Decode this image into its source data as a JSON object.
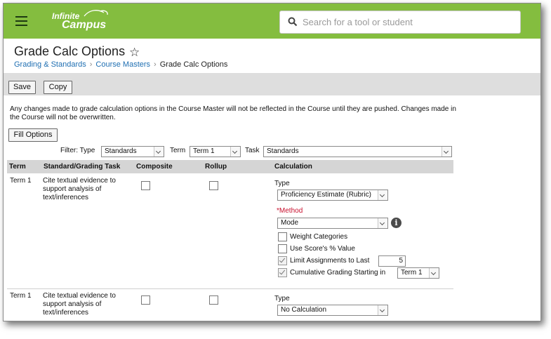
{
  "header": {
    "logo_line1": "Infinite",
    "logo_line2": "Campus",
    "search_placeholder": "Search for a tool or student",
    "brand_color": "#84bd3f"
  },
  "page": {
    "title": "Grade Calc Options",
    "breadcrumbs": [
      "Grading & Standards",
      "Course Masters",
      "Grade Calc Options"
    ]
  },
  "toolbar": {
    "save_label": "Save",
    "copy_label": "Copy"
  },
  "notice": "Any changes made to grade calculation options in the Course Master will not be reflected in the Course until they are pushed. Changes made in the Course will not be overwritten.",
  "fill_options_label": "Fill Options",
  "filter": {
    "filter_type_label": "Filter: Type",
    "type_value": "Standards",
    "term_label": "Term",
    "term_value": "Term 1",
    "task_label": "Task",
    "task_value": "Standards"
  },
  "table": {
    "headers": [
      "Term",
      "Standard/Grading Task",
      "Composite",
      "Rollup",
      "Calculation"
    ],
    "rows": [
      {
        "term": "Term 1",
        "task": "Cite textual evidence to support analysis of text/inferences",
        "composite": false,
        "rollup": false,
        "type_label": "Type",
        "type_value": "Proficiency Estimate (Rubric)",
        "method_required": "*",
        "method_label": "Method",
        "method_value": "Mode",
        "weight_categories_label": "Weight Categories",
        "weight_categories": false,
        "use_score_label": "Use Score's % Value",
        "use_score": false,
        "limit_label": "Limit Assignments to Last",
        "limit": true,
        "limit_value": "5",
        "cumulative_label": "Cumulative Grading Starting in",
        "cumulative": true,
        "cumulative_value": "Term 1"
      },
      {
        "term": "Term 1",
        "task": "Cite textual evidence to support analysis of text/inferences",
        "composite": false,
        "rollup": false,
        "type_label": "Type",
        "type_value": "No Calculation"
      }
    ]
  }
}
